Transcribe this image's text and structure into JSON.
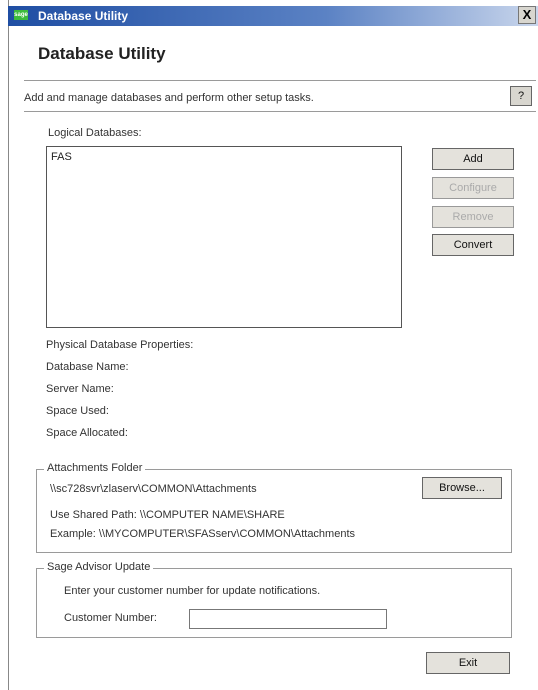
{
  "window": {
    "title": "Database Utility",
    "logo_text": "sage",
    "close_glyph": "X"
  },
  "header": {
    "heading": "Database Utility",
    "subtitle": "Add and manage databases and perform other setup tasks.",
    "help_label": "?"
  },
  "logical": {
    "label": "Logical Databases:",
    "items": [
      "FAS"
    ],
    "buttons": {
      "add": "Add",
      "configure": "Configure",
      "remove": "Remove",
      "convert": "Convert"
    }
  },
  "physical": {
    "heading": "Physical Database Properties:",
    "database_name": "Database Name:",
    "server_name": "Server Name:",
    "space_used": "Space Used:",
    "space_allocated": "Space Allocated:"
  },
  "attachments": {
    "legend": "Attachments Folder",
    "path": "\\\\sc728svr\\zlaserv\\COMMON\\Attachments",
    "browse": "Browse...",
    "shared_path": "Use Shared Path: \\\\COMPUTER NAME\\SHARE",
    "example": "Example: \\\\MYCOMPUTER\\SFASserv\\COMMON\\Attachments"
  },
  "advisor": {
    "legend": "Sage Advisor Update",
    "instruction": "Enter your customer number for update notifications.",
    "customer_label": "Customer Number:",
    "customer_value": ""
  },
  "footer": {
    "exit": "Exit"
  },
  "colors": {
    "titlebar": "#1f4ea3",
    "logo": "#3dbb3d",
    "button_face": "#e4e2dc"
  }
}
